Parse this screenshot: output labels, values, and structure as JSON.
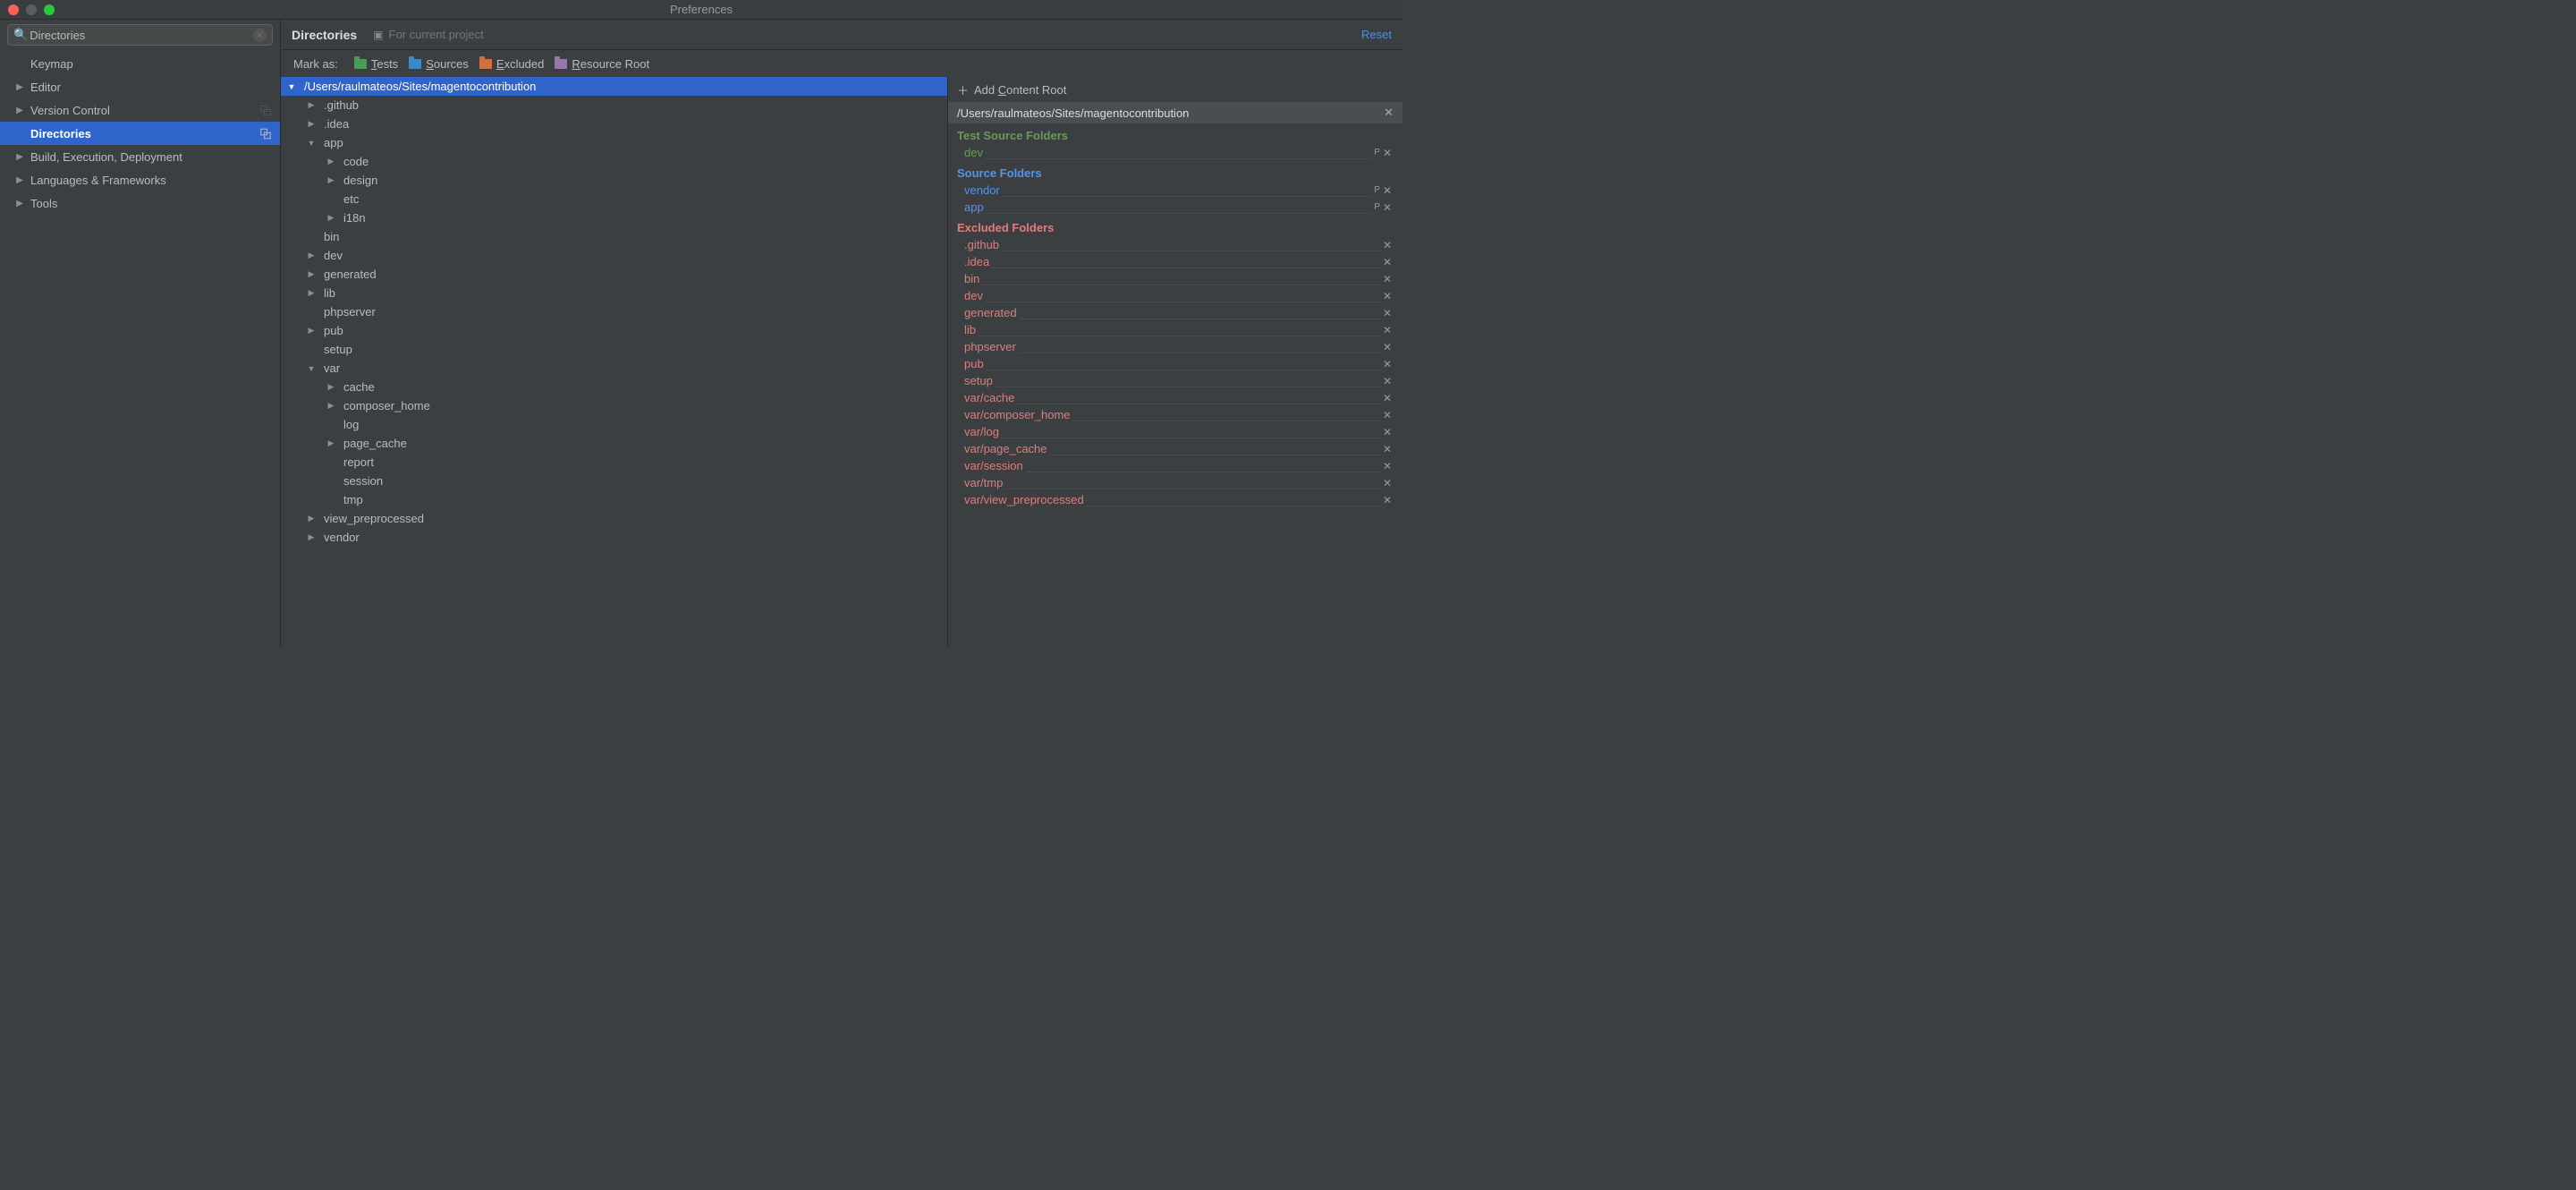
{
  "window": {
    "title": "Preferences"
  },
  "search": {
    "value": "Directories"
  },
  "sidebar": {
    "items": [
      {
        "label": "Keymap",
        "caret": "",
        "selected": false
      },
      {
        "label": "Editor",
        "caret": "▶",
        "selected": false
      },
      {
        "label": "Version Control",
        "caret": "▶",
        "selected": false,
        "badge": "⿻"
      },
      {
        "label": "Directories",
        "caret": "",
        "selected": true,
        "badge": "⿻"
      },
      {
        "label": "Build, Execution, Deployment",
        "caret": "▶",
        "selected": false
      },
      {
        "label": "Languages & Frameworks",
        "caret": "▶",
        "selected": false
      },
      {
        "label": "Tools",
        "caret": "▶",
        "selected": false
      }
    ]
  },
  "header": {
    "title": "Directories",
    "project_label": "For current project",
    "reset_label": "Reset"
  },
  "mark_as": {
    "label": "Mark as:",
    "tests": "Tests",
    "sources": "Sources",
    "excluded": "Excluded",
    "resource": "Resource Root"
  },
  "tree": [
    {
      "indent": 0,
      "caret": "▼",
      "color": "blue",
      "name": "/Users/raulmateos/Sites/magentocontribution",
      "selected": true
    },
    {
      "indent": 1,
      "caret": "▶",
      "color": "orange",
      "name": ".github"
    },
    {
      "indent": 1,
      "caret": "▶",
      "color": "orange",
      "name": ".idea"
    },
    {
      "indent": 1,
      "caret": "▼",
      "color": "blue",
      "name": "app"
    },
    {
      "indent": 2,
      "caret": "▶",
      "color": "gray",
      "name": "code"
    },
    {
      "indent": 2,
      "caret": "▶",
      "color": "gray",
      "name": "design"
    },
    {
      "indent": 2,
      "caret": "",
      "color": "gray",
      "name": "etc"
    },
    {
      "indent": 2,
      "caret": "▶",
      "color": "gray",
      "name": "i18n"
    },
    {
      "indent": 1,
      "caret": "",
      "color": "orange",
      "name": "bin"
    },
    {
      "indent": 1,
      "caret": "▶",
      "color": "orange",
      "name": "dev"
    },
    {
      "indent": 1,
      "caret": "▶",
      "color": "orange",
      "name": "generated"
    },
    {
      "indent": 1,
      "caret": "▶",
      "color": "orange",
      "name": "lib"
    },
    {
      "indent": 1,
      "caret": "",
      "color": "orange",
      "name": "phpserver"
    },
    {
      "indent": 1,
      "caret": "▶",
      "color": "orange",
      "name": "pub"
    },
    {
      "indent": 1,
      "caret": "",
      "color": "orange",
      "name": "setup"
    },
    {
      "indent": 1,
      "caret": "▼",
      "color": "gray",
      "name": "var"
    },
    {
      "indent": 2,
      "caret": "▶",
      "color": "orange",
      "name": "cache"
    },
    {
      "indent": 2,
      "caret": "▶",
      "color": "orange",
      "name": "composer_home"
    },
    {
      "indent": 2,
      "caret": "",
      "color": "orange",
      "name": "log"
    },
    {
      "indent": 2,
      "caret": "▶",
      "color": "orange",
      "name": "page_cache"
    },
    {
      "indent": 2,
      "caret": "",
      "color": "gray",
      "name": "report"
    },
    {
      "indent": 2,
      "caret": "",
      "color": "orange",
      "name": "session"
    },
    {
      "indent": 2,
      "caret": "",
      "color": "orange",
      "name": "tmp"
    },
    {
      "indent": 1,
      "caret": "▶",
      "color": "orange",
      "name": "view_preprocessed"
    },
    {
      "indent": 1,
      "caret": "▶",
      "color": "teal",
      "name": "vendor"
    }
  ],
  "detail": {
    "add_root": "Add Content Root",
    "root_path": "/Users/raulmateos/Sites/magentocontribution",
    "test_head": "Test Source Folders",
    "test_folders": [
      "dev"
    ],
    "src_head": "Source Folders",
    "src_folders": [
      "vendor",
      "app"
    ],
    "excl_head": "Excluded Folders",
    "excl_folders": [
      ".github",
      ".idea",
      "bin",
      "dev",
      "generated",
      "lib",
      "phpserver",
      "pub",
      "setup",
      "var/cache",
      "var/composer_home",
      "var/log",
      "var/page_cache",
      "var/session",
      "var/tmp",
      "var/view_preprocessed"
    ]
  }
}
